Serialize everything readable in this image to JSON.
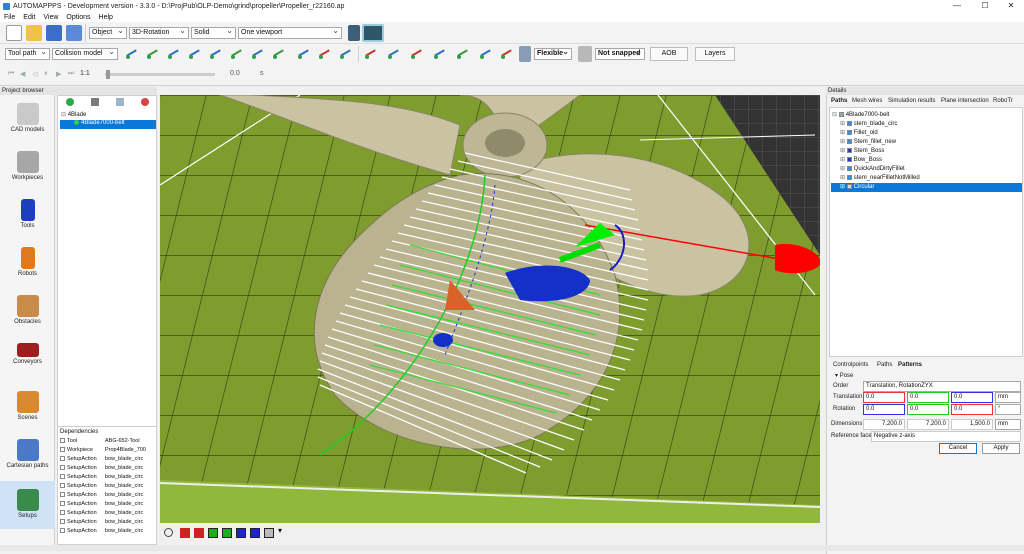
{
  "window": {
    "title": "AUTOMAPPPS - Development version - 3.3.0 - D:\\ProjPub\\OLP-Demo\\grind\\propeller\\Propeller_r22160.ap",
    "min": "—",
    "max": "☐",
    "close": "✕"
  },
  "menu": [
    "File",
    "Edit",
    "View",
    "Options",
    "Help"
  ],
  "toolbar": {
    "object_select": "Object",
    "rotation_select": "3D-Rotation",
    "shading_select": "Solid",
    "viewport_select": "One viewport",
    "toolpath_select": "Tool path",
    "collision_select": "Collision model",
    "flexible_select": "Flexible",
    "snap_select": "Not snapped",
    "aob_label": "AOB",
    "layers_label": "Layers",
    "speed_value": "1:1",
    "time_value": "0.0",
    "time_unit": "s"
  },
  "left_nav": {
    "header": "Project browser",
    "items": [
      "CAD models",
      "Workpieces",
      "Tools",
      "Robots",
      "Obstacles",
      "Conveyors",
      "Scenes",
      "Cartesian paths",
      "Setups"
    ]
  },
  "tree": {
    "root": "4Blade",
    "child": "4Blade7000-belt"
  },
  "dependencies": {
    "header": "Dependencies",
    "rows": [
      [
        "Tool",
        "ABG-652-Tool"
      ],
      [
        "Workpiece",
        "Prop4Blade_700"
      ],
      [
        "SetupAction",
        "bow_blade_circ"
      ],
      [
        "SetupAction",
        "bow_blade_circ"
      ],
      [
        "SetupAction",
        "bow_blade_circ"
      ],
      [
        "SetupAction",
        "bow_blade_circ"
      ],
      [
        "SetupAction",
        "bow_blade_circ"
      ],
      [
        "SetupAction",
        "bow_blade_circ"
      ],
      [
        "SetupAction",
        "bow_blade_circ"
      ],
      [
        "SetupAction",
        "bow_blade_circ"
      ],
      [
        "SetupAction",
        "bow_blade_circ"
      ]
    ]
  },
  "details": {
    "header": "Details",
    "tabs": [
      "Paths",
      "Mesh wires",
      "Simulation results",
      "Plane intersection",
      "RoboTr"
    ],
    "tree_root": "4Blade7000-belt",
    "paths": [
      "stem_blade_circ",
      "Fillet_old",
      "Stem_fillet_new",
      "Stem_Boss",
      "Bow_Boss",
      "QuickAndDirtyFillet",
      "stem_nearFilletNotMilled",
      "Circular"
    ],
    "sub_tabs": [
      "Controlpoints",
      "Paths",
      "Patterns"
    ],
    "pose_label": "Pose",
    "order_label": "Order",
    "order_value": "Translation, RotationZYX",
    "translation_label": "Translation",
    "translation": [
      "0.0",
      "0.0",
      "0.0"
    ],
    "translation_unit": "mm",
    "rotation_label": "Rotation",
    "rotation": [
      "0.0",
      "0.0",
      "0.0"
    ],
    "rotation_unit": "°",
    "dimensions_label": "Dimensions",
    "dimensions": [
      "7,200.0",
      "7,200.0",
      "1,500.0"
    ],
    "dimensions_unit": "mm",
    "reference_label": "Reference face",
    "reference_value": "Negative z-axis",
    "cancel": "Cancel",
    "apply": "Apply"
  },
  "colors": {
    "accent": "#0078d7",
    "ground": "#7d9a2e",
    "propeller": "#c9c3a2",
    "axis_x": "#ff0000",
    "axis_y": "#00dd00",
    "axis_z": "#0000cc"
  }
}
